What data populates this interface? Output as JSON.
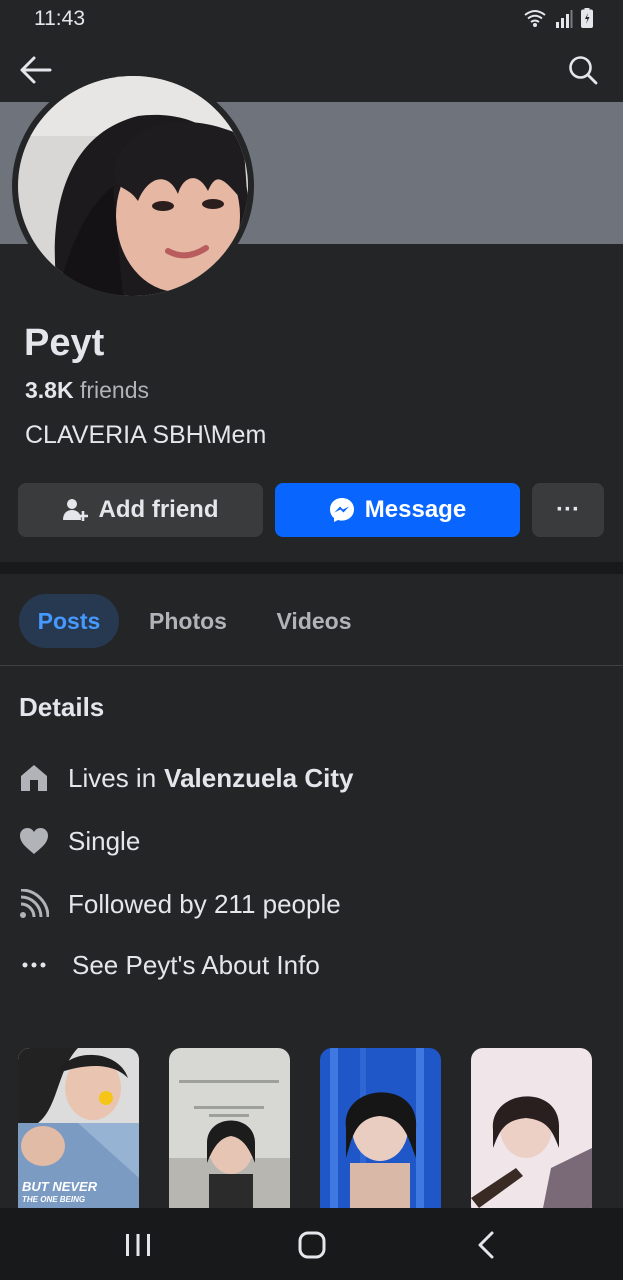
{
  "status": {
    "time": "11:43"
  },
  "profile": {
    "name": "Peyt",
    "friends_count": "3.8K",
    "friends_label": "friends",
    "bio": "CLAVERIA SBH\\Mem"
  },
  "actions": {
    "add_friend": "Add friend",
    "message": "Message",
    "more": "···"
  },
  "tabs": [
    {
      "label": "Posts",
      "active": true
    },
    {
      "label": "Photos",
      "active": false
    },
    {
      "label": "Videos",
      "active": false
    }
  ],
  "details": {
    "title": "Details",
    "lives_prefix": "Lives in",
    "lives_city": "Valenzuela City",
    "relationship": "Single",
    "followers": "Followed by 211 people",
    "about": "See Peyt's About Info"
  },
  "photo_texts": {
    "p1_line1": "BUT NEVER",
    "p1_line2": "THE ONE BEING"
  },
  "icons": [
    "back-arrow-icon",
    "search-icon",
    "add-friend-icon",
    "messenger-icon",
    "more-dots-icon",
    "home-icon",
    "heart-icon",
    "rss-icon",
    "ellipsis-icon",
    "recent-apps-icon",
    "home-nav-icon",
    "back-nav-icon"
  ],
  "colors": {
    "accent": "#0866ff",
    "tab_active_bg": "#263951",
    "tab_active_text": "#4599ff"
  }
}
